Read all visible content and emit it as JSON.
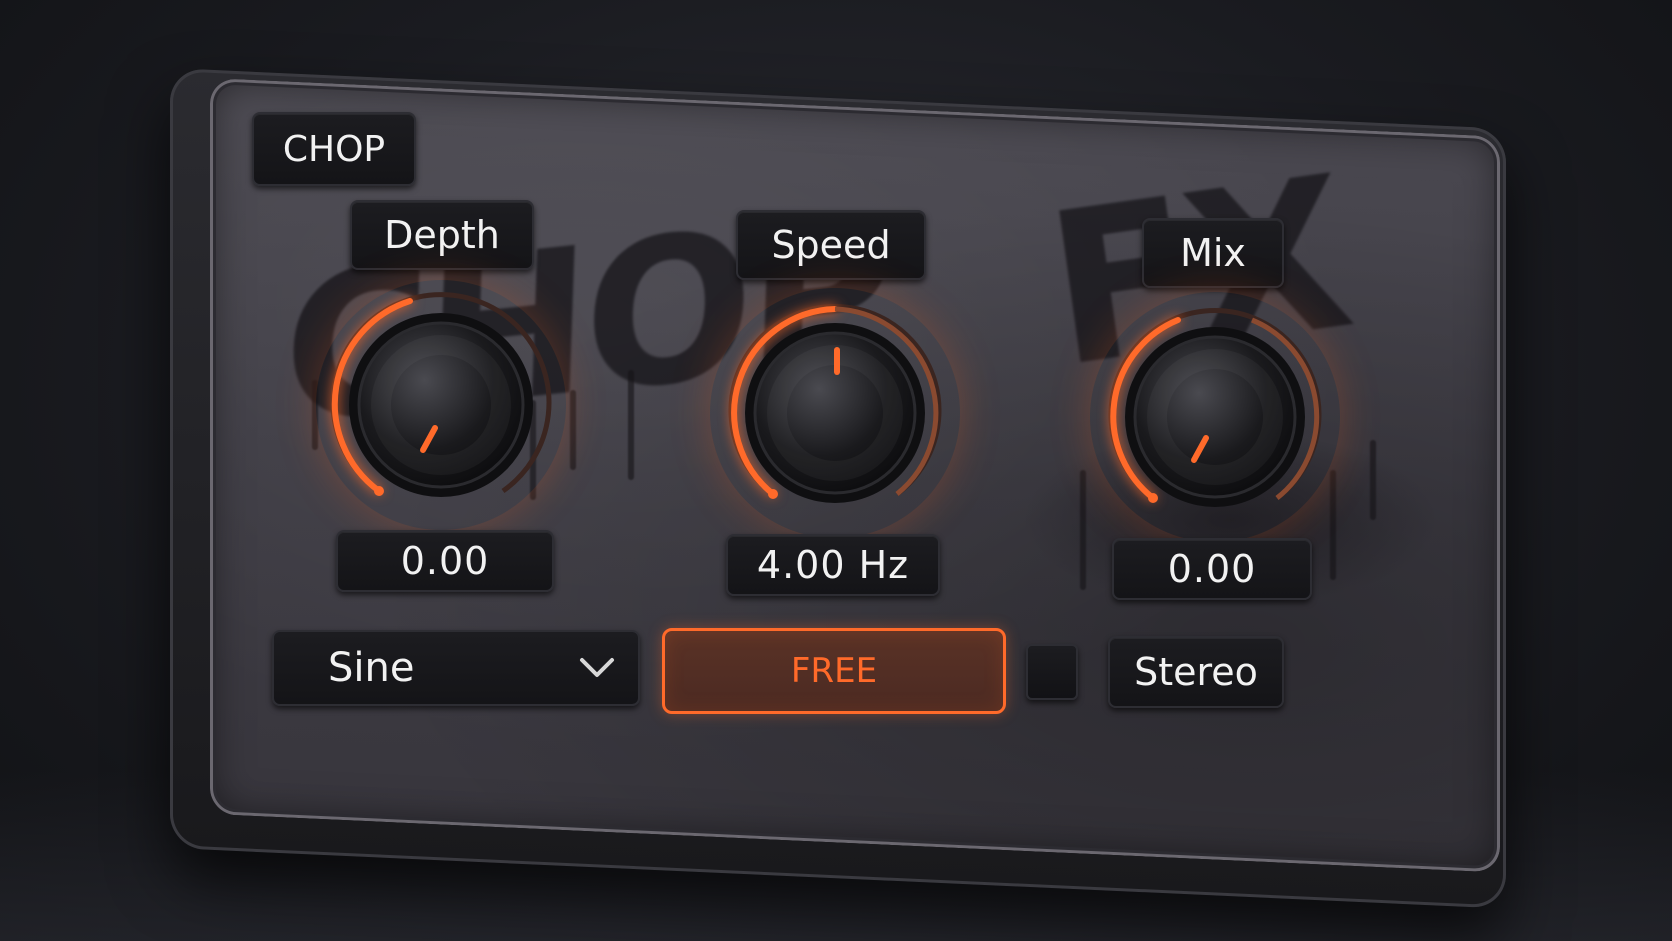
{
  "plugin": {
    "title": "CHOP",
    "graffiti_left": "CHOP",
    "graffiti_right": "FX"
  },
  "knobs": [
    {
      "id": "depth",
      "label": "Depth",
      "value": "0.00"
    },
    {
      "id": "speed",
      "label": "Speed",
      "value": "4.00 Hz"
    },
    {
      "id": "mix",
      "label": "Mix",
      "value": "0.00"
    }
  ],
  "controls": {
    "waveform": "Sine",
    "sync_mode": "FREE",
    "channel_mode": "Stereo"
  },
  "colors": {
    "accent": "#ff6a2a",
    "panel": "#3e3c44",
    "label_bg": "#16161a",
    "text": "#f2f2f2"
  },
  "icons": {
    "dropdown": "chevron-down-icon"
  }
}
